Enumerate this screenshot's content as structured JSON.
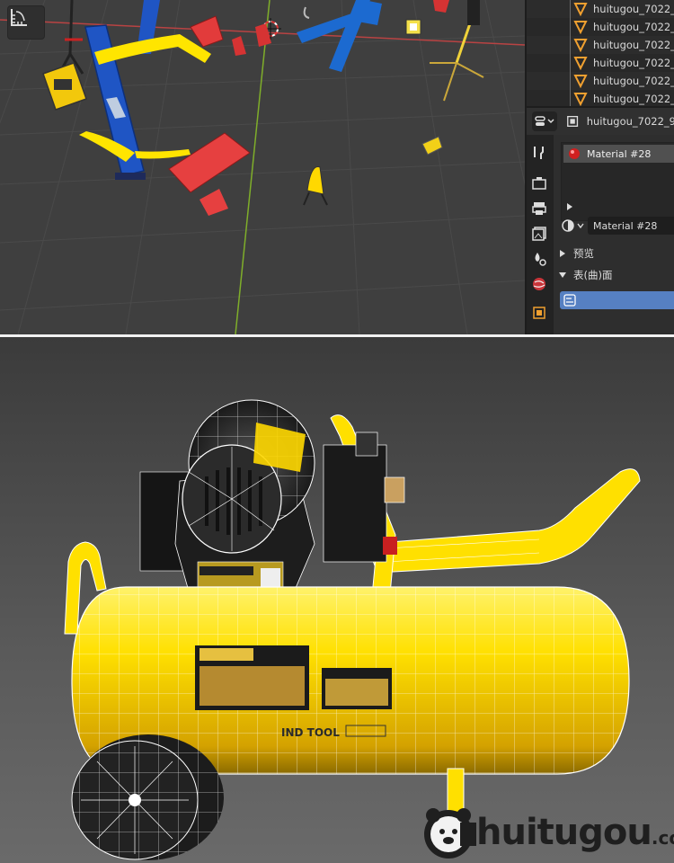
{
  "outliner": {
    "items": [
      {
        "label": "huitugou_7022_"
      },
      {
        "label": "huitugou_7022_"
      },
      {
        "label": "huitugou_7022_"
      },
      {
        "label": "huitugou_7022_"
      },
      {
        "label": "huitugou_7022_"
      },
      {
        "label": "huitugou_7022_"
      }
    ]
  },
  "properties": {
    "object_name": "huitugou_7022_9",
    "material_slot": "Material #28",
    "material_field": "Material #28",
    "panel_preview": "预览",
    "panel_surface": "表(曲)面"
  },
  "render": {
    "decal_brand": "IND TOOL"
  },
  "watermark": {
    "word": "huitugou",
    "suffix": ".com"
  },
  "colors": {
    "accent_blue": "#5680c2",
    "outliner_icon": "#f0a030",
    "axis_red": "#d43a3a",
    "axis_green": "#8dbb2f",
    "compressor_yellow": "#ffd800"
  }
}
